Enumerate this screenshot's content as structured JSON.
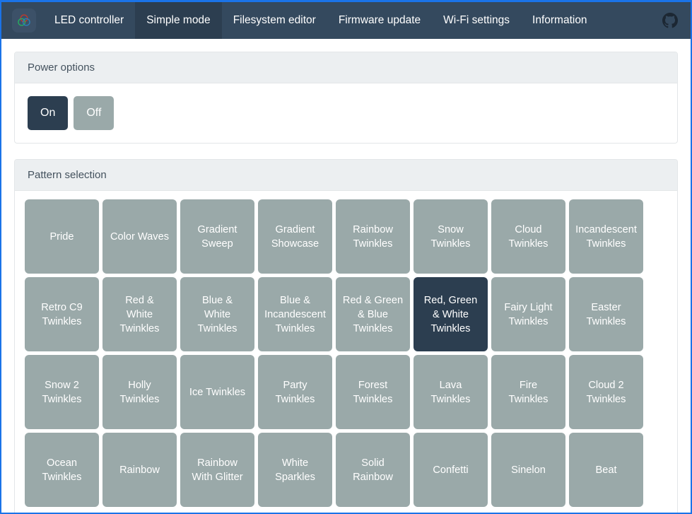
{
  "navbar": {
    "brand_icon": "rgb-venn-logo-icon",
    "items": [
      {
        "label": "LED controller",
        "active": false
      },
      {
        "label": "Simple mode",
        "active": true
      },
      {
        "label": "Filesystem editor",
        "active": false
      },
      {
        "label": "Firmware update",
        "active": false
      },
      {
        "label": "Wi-Fi settings",
        "active": false
      },
      {
        "label": "Information",
        "active": false
      }
    ],
    "github_icon": "github-icon",
    "bg_color": "#34495e",
    "active_bg_color": "#2c3e50"
  },
  "power_card": {
    "title": "Power options",
    "buttons": [
      {
        "label": "On",
        "state": "active"
      },
      {
        "label": "Off",
        "state": "inactive"
      }
    ]
  },
  "pattern_card": {
    "title": "Pattern selection",
    "selected": "Red, Green\n& White\nTwinkles",
    "buttons": [
      {
        "label": "Pride",
        "selected": false
      },
      {
        "label": "Color Waves",
        "selected": false
      },
      {
        "label": "Gradient\nSweep",
        "selected": false
      },
      {
        "label": "Gradient\nShowcase",
        "selected": false
      },
      {
        "label": "Rainbow\nTwinkles",
        "selected": false
      },
      {
        "label": "Snow\nTwinkles",
        "selected": false
      },
      {
        "label": "Cloud\nTwinkles",
        "selected": false
      },
      {
        "label": "Incandescent\nTwinkles",
        "selected": false
      },
      {
        "label": "Retro C9\nTwinkles",
        "selected": false
      },
      {
        "label": "Red &\nWhite\nTwinkles",
        "selected": false
      },
      {
        "label": "Blue &\nWhite\nTwinkles",
        "selected": false
      },
      {
        "label": "Blue &\nIncandescent\nTwinkles",
        "selected": false
      },
      {
        "label": "Red & Green\n& Blue\nTwinkles",
        "selected": false
      },
      {
        "label": "Red, Green\n& White\nTwinkles",
        "selected": true
      },
      {
        "label": "Fairy Light\nTwinkles",
        "selected": false
      },
      {
        "label": "Easter\nTwinkles",
        "selected": false
      },
      {
        "label": "Snow 2\nTwinkles",
        "selected": false
      },
      {
        "label": "Holly\nTwinkles",
        "selected": false
      },
      {
        "label": "Ice Twinkles",
        "selected": false
      },
      {
        "label": "Party\nTwinkles",
        "selected": false
      },
      {
        "label": "Forest\nTwinkles",
        "selected": false
      },
      {
        "label": "Lava\nTwinkles",
        "selected": false
      },
      {
        "label": "Fire\nTwinkles",
        "selected": false
      },
      {
        "label": "Cloud 2\nTwinkles",
        "selected": false
      },
      {
        "label": "Ocean\nTwinkles",
        "selected": false
      },
      {
        "label": "Rainbow",
        "selected": false
      },
      {
        "label": "Rainbow\nWith Glitter",
        "selected": false
      },
      {
        "label": "White\nSparkles",
        "selected": false
      },
      {
        "label": "Solid\nRainbow",
        "selected": false
      },
      {
        "label": "Confetti",
        "selected": false
      },
      {
        "label": "Sinelon",
        "selected": false
      },
      {
        "label": "Beat",
        "selected": false
      }
    ]
  },
  "colors": {
    "nav_bg": "#34495e",
    "nav_active_bg": "#2c3e50",
    "accent_dark": "#2c3e50",
    "btn_idle": "#9aa9a9",
    "card_header_bg": "#eceff1",
    "page_focus_border": "#1a73e8"
  }
}
